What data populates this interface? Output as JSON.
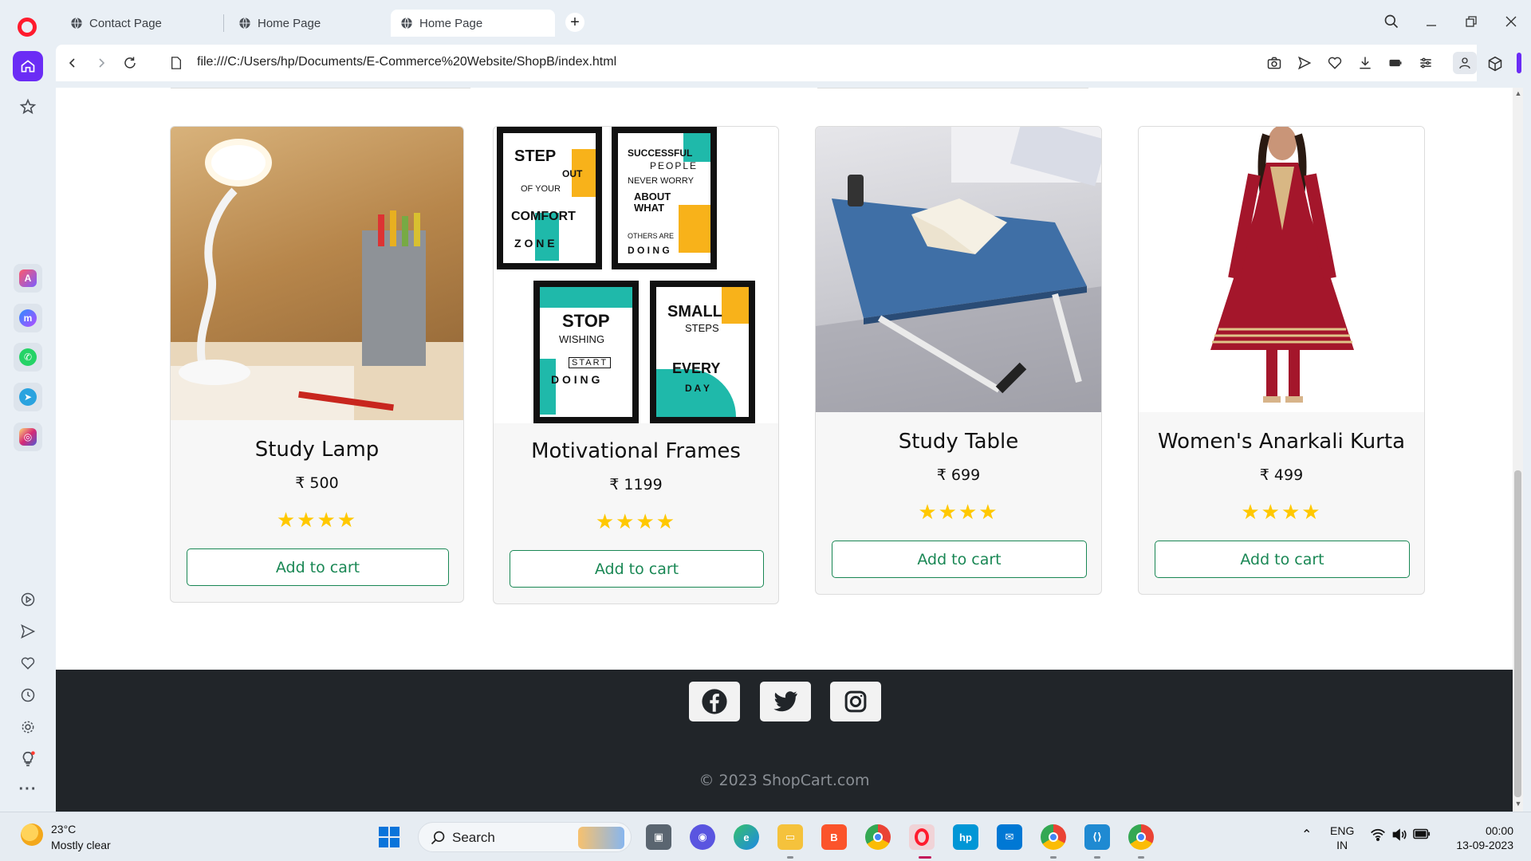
{
  "browser": {
    "tabs": [
      {
        "label": "Contact Page",
        "active": false
      },
      {
        "label": "Home Page",
        "active": false
      },
      {
        "label": "Home Page",
        "active": true
      }
    ],
    "url": "file:///C:/Users/hp/Documents/E-Commerce%20Website/ShopB/index.html"
  },
  "products": [
    {
      "title": "Study Lamp",
      "price": "₹ 500",
      "rating": 4,
      "stars": "★★★★",
      "button": "Add to cart",
      "image": "study-lamp"
    },
    {
      "title": "Motivational Frames",
      "price": "₹ 1199",
      "rating": 4,
      "stars": "★★★★",
      "button": "Add to cart",
      "image": "motivational-frames",
      "frame_texts": [
        {
          "lines": [
            "STEP",
            "OUT",
            "OF YOUR",
            "COMFORT",
            "Z O N E"
          ]
        },
        {
          "lines": [
            "SUCCESSFUL",
            "PEOPLE",
            "NEVER WORRY",
            "ABOUT",
            "WHAT",
            "OTHERS ARE",
            "D O I N G"
          ]
        },
        {
          "lines": [
            "STOP",
            "WISHING",
            "START",
            "D O I N G"
          ]
        },
        {
          "lines": [
            "SMALL",
            "STEPS",
            "EVERY",
            "D A Y"
          ]
        }
      ]
    },
    {
      "title": "Study Table",
      "price": "₹ 699",
      "rating": 4,
      "stars": "★★★★",
      "button": "Add to cart",
      "image": "study-table"
    },
    {
      "title": "Women's Anarkali Kurta",
      "price": "₹ 499",
      "rating": 4,
      "stars": "★★★★",
      "button": "Add to cart",
      "image": "anarkali-kurta"
    }
  ],
  "footer": {
    "social": [
      "facebook-icon",
      "twitter-icon",
      "instagram-icon"
    ],
    "copyright": "© 2023 ShopCart.com"
  },
  "taskbar": {
    "weather_temp": "23°C",
    "weather_desc": "Mostly clear",
    "search_label": "Search",
    "lang_top": "ENG",
    "lang_bottom": "IN",
    "time": "00:00",
    "date": "13-09-2023"
  },
  "colors": {
    "cart_green": "#198754",
    "star_yellow": "#ffc800",
    "footer_bg": "#212529",
    "opera_accent": "#6b2cf5"
  }
}
